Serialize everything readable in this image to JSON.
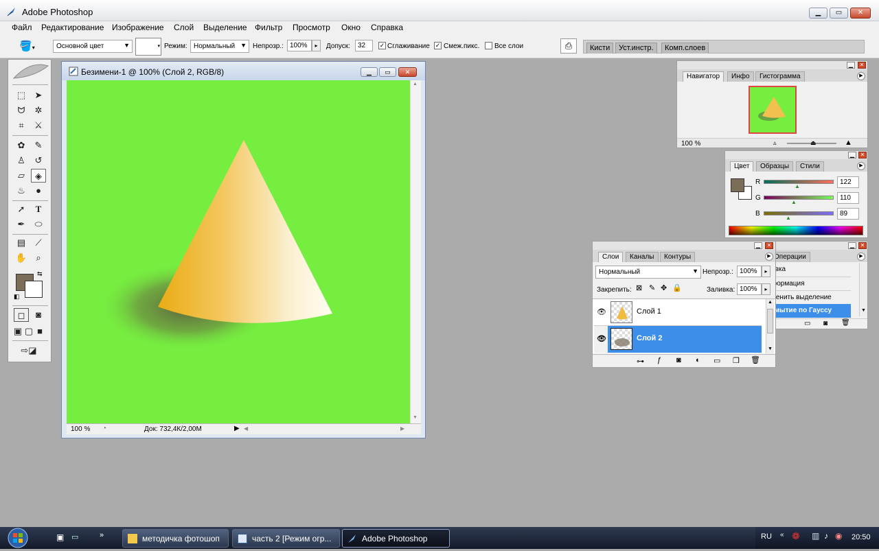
{
  "app": {
    "title": "Adobe Photoshop"
  },
  "menu": [
    "Файл",
    "Редактирование",
    "Изображение",
    "Слой",
    "Выделение",
    "Фильтр",
    "Просмотр",
    "Окно",
    "Справка"
  ],
  "options": {
    "fill_source": "Основной цвет",
    "mode_label": "Режим:",
    "mode_value": "Нормальный",
    "opacity_label": "Непрозр.:",
    "opacity_value": "100%",
    "tolerance_label": "Допуск:",
    "tolerance_value": "32",
    "antialias_label": "Сглаживание",
    "contiguous_label": "Смеж.пикс.",
    "all_layers_label": "Все слои",
    "well_tabs": [
      "Кисти",
      "Уст.инстр.",
      "Комп.слоев"
    ]
  },
  "document": {
    "title": "Безимени-1 @ 100% (Слой 2, RGB/8)",
    "zoom": "100 %",
    "doc_size": "Док: 732,4К/2,00М",
    "canvas_color": "#76ee40"
  },
  "colors": {
    "foreground": "#7a6e59",
    "background": "#ffffff"
  },
  "navigator": {
    "tabs": [
      "Навигатор",
      "Инфо",
      "Гистограмма"
    ],
    "zoom": "100 %"
  },
  "color_panel": {
    "tabs": [
      "Цвет",
      "Образцы",
      "Стили"
    ],
    "r_label": "R",
    "r_value": "122",
    "g_label": "G",
    "g_value": "110",
    "b_label": "B",
    "b_value": "89"
  },
  "layers_panel": {
    "tabs": [
      "Слои",
      "Каналы",
      "Контуры"
    ],
    "blend_mode": "Нормальный",
    "opacity_label": "Непрозр.:",
    "opacity_value": "100%",
    "lock_label": "Закрепить:",
    "fill_label": "Заливка:",
    "fill_value": "100%",
    "layers": [
      {
        "name": "Слой 1",
        "selected": false
      },
      {
        "name": "Слой 2",
        "selected": true
      }
    ]
  },
  "history_panel": {
    "tab": "Операции",
    "items": [
      "ивка",
      "формация",
      "менить выделение",
      "змытие по Гауссу"
    ],
    "selected_index": 3
  },
  "taskbar": {
    "tasks": [
      "методичка фотошоп",
      "часть 2 [Режим огр...",
      "Adobe Photoshop"
    ],
    "language": "RU",
    "time": "20:50"
  }
}
